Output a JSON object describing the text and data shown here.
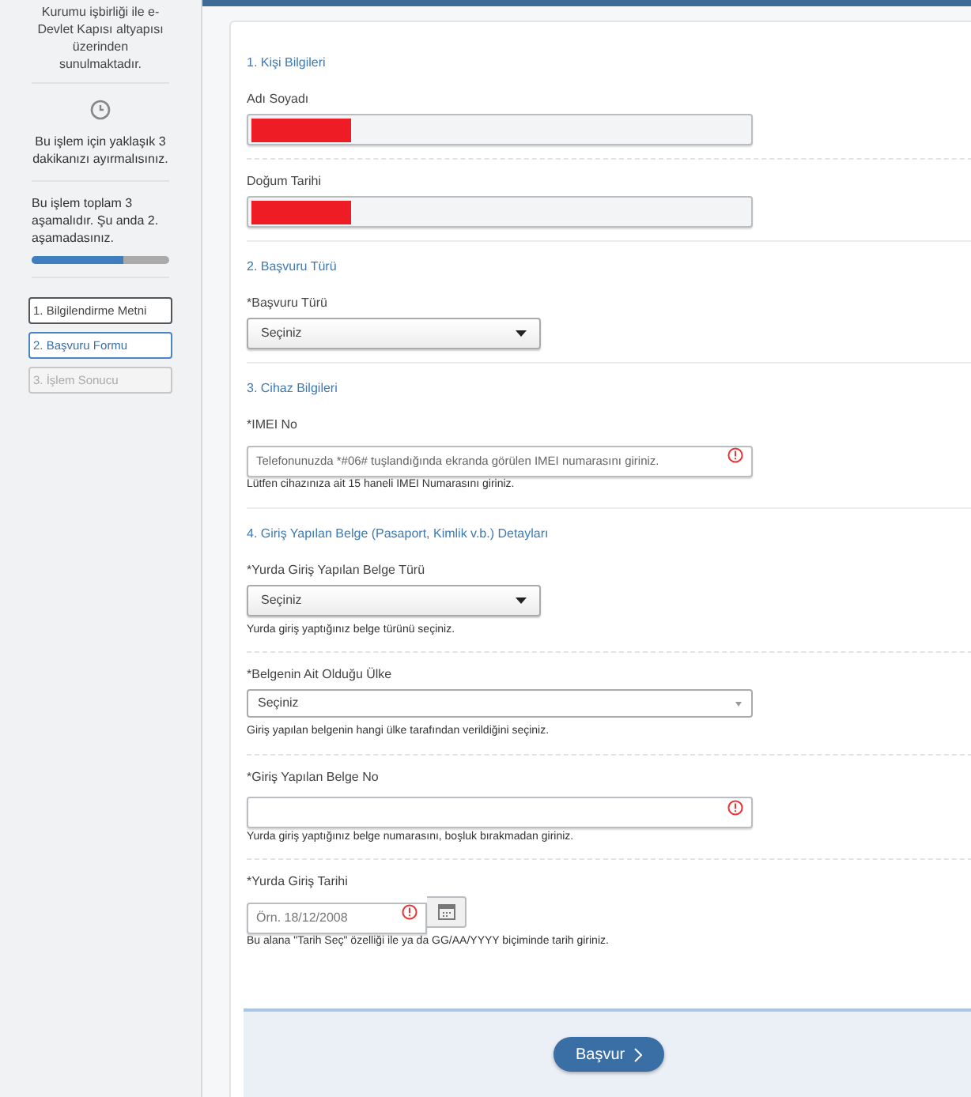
{
  "sidebar": {
    "intro": "Kurumu işbirliği ile e-Devlet Kapısı altyapısı üzerinden sunulmaktadır.",
    "time_note": "Bu işlem için yaklaşık 3 dakikanızı ayırmalısınız.",
    "progress": {
      "text": "Bu işlem toplam 3 aşamalıdır. Şu anda 2. aşamadasınız.",
      "level": 0.67
    },
    "steps": [
      {
        "label": "1. Bilgilendirme Metni",
        "completed": true,
        "selected": false
      },
      {
        "label": "2. Başvuru Formu",
        "completed": false,
        "selected": true
      },
      {
        "label": "3. İşlem Sonucu",
        "completed": false,
        "selected": false
      }
    ]
  },
  "form": {
    "sections": [
      {
        "title": "1. Kişi Bilgileri",
        "fields": [
          {
            "kind": "readonly",
            "label": "Adı Soyadı",
            "redacted": true
          },
          {
            "kind": "readonly",
            "label": "Doğum Tarihi",
            "redacted": true
          }
        ]
      },
      {
        "title": "2. Başvuru Türü",
        "fields": [
          {
            "kind": "dropdown",
            "label": "*Başvuru Türü",
            "value": "Seçiniz"
          }
        ]
      },
      {
        "title": "3. Cihaz Bilgileri",
        "fields": [
          {
            "kind": "text",
            "label": "*IMEI No",
            "placeholder": "Telefonunuzda *#06# tuşlandığında ekranda görülen IMEI numarasını giriniz.",
            "help": "Lütfen cihazınıza ait 15 haneli IMEI Numarasını giriniz.",
            "error": true
          }
        ]
      },
      {
        "title": "4. Giriş Yapılan Belge (Pasaport, Kimlik v.b.) Detayları",
        "fields": [
          {
            "kind": "dropdown",
            "label": "*Yurda Giriş Yapılan Belge Türü",
            "value": "Seçiniz",
            "help": "Yurda giriş yaptığınız belge türünü seçiniz."
          },
          {
            "kind": "combo",
            "label": "*Belgenin Ait Olduğu Ülke",
            "value": "Seçiniz",
            "help": "Giriş yapılan belgenin hangi ülke tarafından verildiğini seçiniz."
          },
          {
            "kind": "text",
            "label": "*Giriş Yapılan Belge No",
            "help": "Yurda giriş yaptığınız belge numarasını, boşluk bırakmadan giriniz.",
            "error": true
          },
          {
            "kind": "date",
            "label": "*Yurda Giriş Tarihi",
            "placeholder": "Örn. 18/12/2008",
            "help": "Bu alana \"Tarih Seç\" özelliği ile ya da GG/AA/YYYY biçiminde tarih giriniz.",
            "error": true
          }
        ]
      }
    ],
    "submit": "Başvur"
  }
}
